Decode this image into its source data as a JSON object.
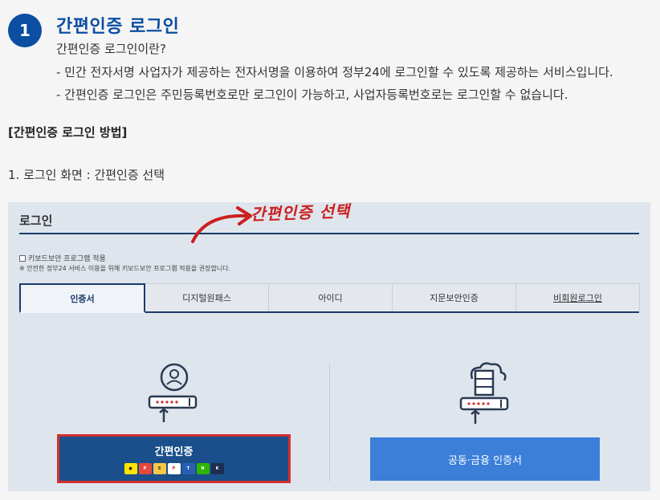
{
  "step": {
    "number": "1",
    "title": "간편인증 로그인"
  },
  "intro": {
    "question": "간편인증 로그인이란?",
    "bullet1": "- 민간 전자서명 사업자가 제공하는 전자서명을 이용하여 정부24에 로그인할 수 있도록 제공하는 서비스입니다.",
    "bullet2": "- 간편인증 로그인은 주민등록번호로만 로그인이 가능하고, 사업자등록번호로는 로그인할 수 없습니다."
  },
  "method_title": "[간편인증 로그인 방법]",
  "step1_text": "1. 로그인 화면 : 간편인증 선택",
  "login": {
    "title": "로그인",
    "keyboard_security_label": "키보드보안 프로그램 적용",
    "keyboard_security_note": "※ 안전한 정부24 서비스 이용을 위해 키보드보안 프로그램 적용을 권장합니다.",
    "tabs": [
      {
        "label": "인증서"
      },
      {
        "label": "디지털원패스"
      },
      {
        "label": "아이디"
      },
      {
        "label": "지문보안인증"
      },
      {
        "label": "비회원로그인"
      }
    ],
    "simple_auth_button": "간편인증",
    "providers": [
      "kakao-icon",
      "pass-icon",
      "samsung-pass-icon",
      "payco-icon",
      "toss-icon",
      "naver-icon",
      "kb-icon"
    ],
    "cert_button": "공동·금융 인증서"
  },
  "annotation": "간편인증 선택",
  "colors": {
    "brand": "#0b4ea2",
    "highlight": "#d32f2f",
    "button_dark": "#1a4f8b",
    "button_light": "#3b7fd9"
  }
}
